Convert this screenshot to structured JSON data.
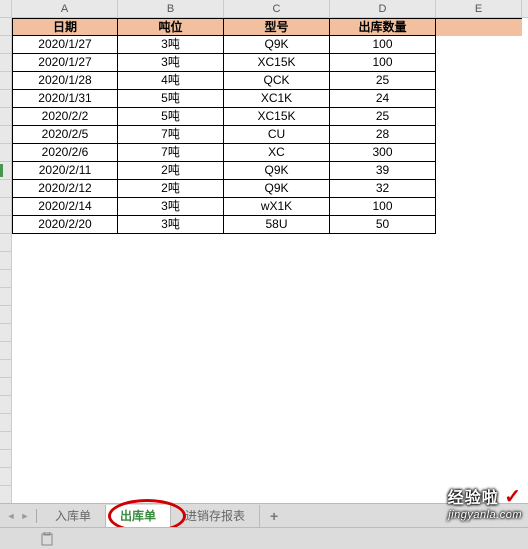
{
  "columns": [
    "A",
    "B",
    "C",
    "D",
    "E"
  ],
  "headers": [
    "日期",
    "吨位",
    "型号",
    "出库数量"
  ],
  "rows": [
    [
      "2020/1/27",
      "3吨",
      "Q9K",
      "100"
    ],
    [
      "2020/1/27",
      "3吨",
      "XC15K",
      "100"
    ],
    [
      "2020/1/28",
      "4吨",
      "QCK",
      "25"
    ],
    [
      "2020/1/31",
      "5吨",
      "XC1K",
      "24"
    ],
    [
      "2020/2/2",
      "5吨",
      "XC15K",
      "25"
    ],
    [
      "2020/2/5",
      "7吨",
      "CU",
      "28"
    ],
    [
      "2020/2/6",
      "7吨",
      "XC",
      "300"
    ],
    [
      "2020/2/11",
      "2吨",
      "Q9K",
      "39"
    ],
    [
      "2020/2/12",
      "2吨",
      "Q9K",
      "32"
    ],
    [
      "2020/2/14",
      "3吨",
      "wX1K",
      "100"
    ],
    [
      "2020/2/20",
      "3吨",
      "58U",
      "50"
    ]
  ],
  "active_row_index": 8,
  "tabs": {
    "items": [
      "入库单",
      "出库单",
      "进销存报表"
    ],
    "active": 1,
    "add_label": "+"
  },
  "watermark": {
    "text": "经验啦",
    "check": "✓",
    "url": "jingyanla.com"
  }
}
